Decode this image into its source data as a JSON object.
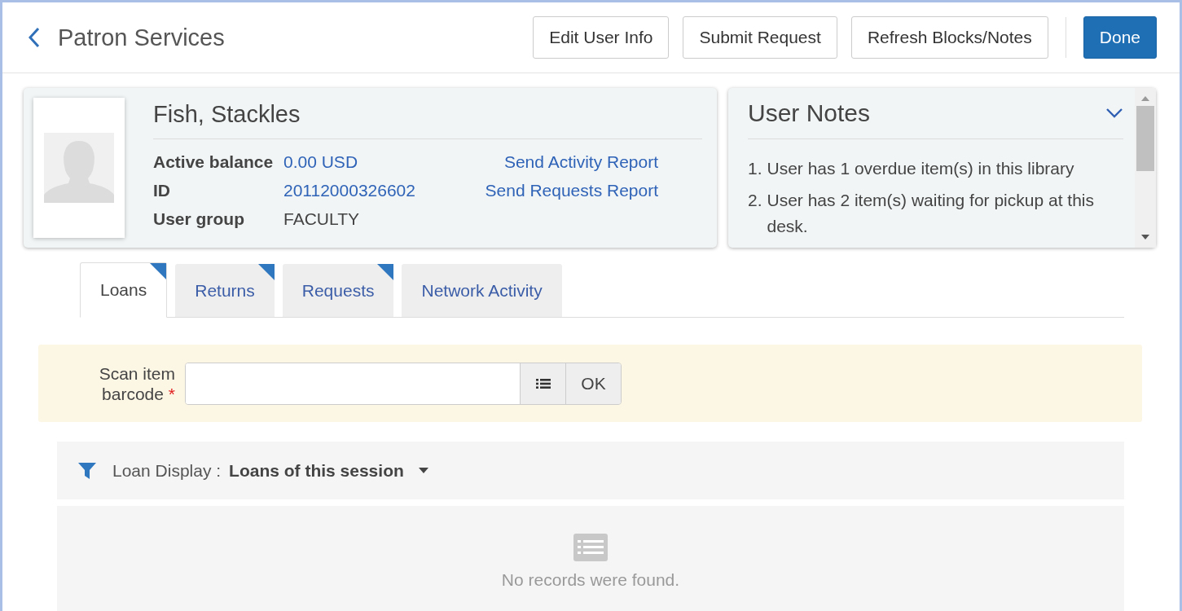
{
  "header": {
    "title": "Patron Services",
    "buttons": [
      {
        "label": "Edit User Info",
        "kind": "secondary"
      },
      {
        "label": "Submit Request",
        "kind": "secondary"
      },
      {
        "label": "Refresh Blocks/Notes",
        "kind": "secondary"
      },
      {
        "label": "Done",
        "kind": "primary"
      }
    ]
  },
  "patron": {
    "name": "Fish, Stackles",
    "fields": [
      {
        "label": "Active balance",
        "value": "0.00 USD",
        "link": true
      },
      {
        "label": "ID",
        "value": "20112000326602",
        "link": true
      },
      {
        "label": "User group",
        "value": "FACULTY",
        "link": false
      }
    ],
    "actions": [
      "Send Activity Report",
      "Send Requests Report"
    ]
  },
  "user_notes": {
    "title": "User Notes",
    "expanded": true,
    "notes": [
      {
        "number": "1.",
        "text": "User has 1 overdue item(s) in this library"
      },
      {
        "number": "2.",
        "text": "User has 2 item(s) waiting for pickup at this desk."
      }
    ]
  },
  "tabs": [
    {
      "label": "Loans",
      "selected": true,
      "flagged": true
    },
    {
      "label": "Returns",
      "selected": false,
      "flagged": true
    },
    {
      "label": "Requests",
      "selected": false,
      "flagged": true
    },
    {
      "label": "Network Activity",
      "selected": false,
      "flagged": false
    }
  ],
  "scan": {
    "label": "Scan item barcode",
    "required_mark": "*",
    "button": "OK"
  },
  "loan_display": {
    "label": "Loan Display :",
    "value": "Loans of this session"
  },
  "empty_message": "No records were found."
}
